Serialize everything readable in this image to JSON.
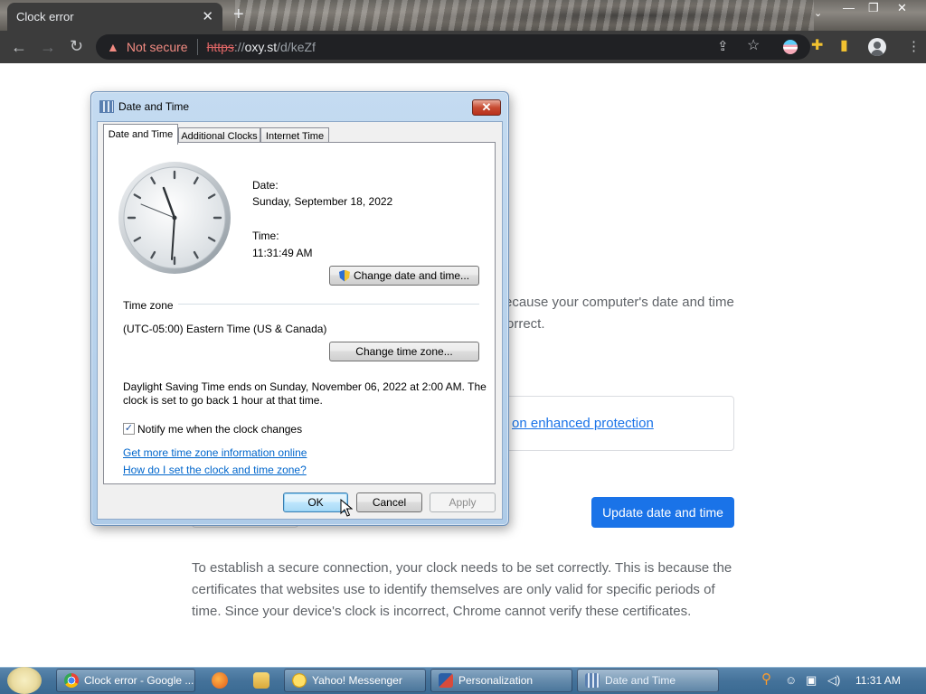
{
  "browser": {
    "tab_title": "Clock error",
    "tab_close": "✕",
    "new_tab": "+",
    "security_label": "Not secure",
    "url_scheme": "https",
    "url_sep": "://",
    "url_host": "oxy.st",
    "url_path": "/d/keZf"
  },
  "page": {
    "body_line1": "ecause your computer's date and time",
    "body_line2": "orrect.",
    "protection_link": "on enhanced protection",
    "update_button": "Update date and time",
    "explanation": "To establish a secure connection, your clock needs to be set correctly. This is because the certificates that websites use to identify themselves are only valid for specific periods of time. Since your device's clock is incorrect, Chrome cannot verify these certificates."
  },
  "dialog": {
    "title": "Date and Time",
    "close": "✕",
    "tabs": [
      "Date and Time",
      "Additional Clocks",
      "Internet Time"
    ],
    "date_label": "Date:",
    "date_value": "Sunday, September 18, 2022",
    "time_label": "Time:",
    "time_value": "11:31:49 AM",
    "change_datetime_button": "Change date and time...",
    "timezone_heading": "Time zone",
    "timezone_value": "(UTC-05:00) Eastern Time (US & Canada)",
    "change_timezone_button": "Change time zone...",
    "dst_line1": "Daylight Saving Time ends on Sunday, November 06, 2022 at 2:00 AM. The",
    "dst_line2": "clock is set to go back 1 hour at that time.",
    "notify_checkbox_label": "Notify me when the clock changes",
    "notify_checked": true,
    "link_more_info": "Get more time zone information online",
    "link_how_to": "How do I set the clock and time zone?",
    "ok_button": "OK",
    "cancel_button": "Cancel",
    "apply_button": "Apply"
  },
  "taskbar": {
    "items": [
      {
        "label": "Clock error - Google ...",
        "icon": "chrome-icon"
      },
      {
        "label": "Yahoo! Messenger",
        "icon": "yahoo-messenger-icon"
      },
      {
        "label": "Personalization",
        "icon": "personalization-icon"
      },
      {
        "label": "Date and Time",
        "icon": "date-time-icon"
      }
    ],
    "clock": "11:31 AM"
  },
  "colors": {
    "chrome_dark": "#3c3c3c",
    "not_secure_red": "#f28b82",
    "google_blue": "#1a73e8",
    "dialog_link": "#0066cc"
  }
}
